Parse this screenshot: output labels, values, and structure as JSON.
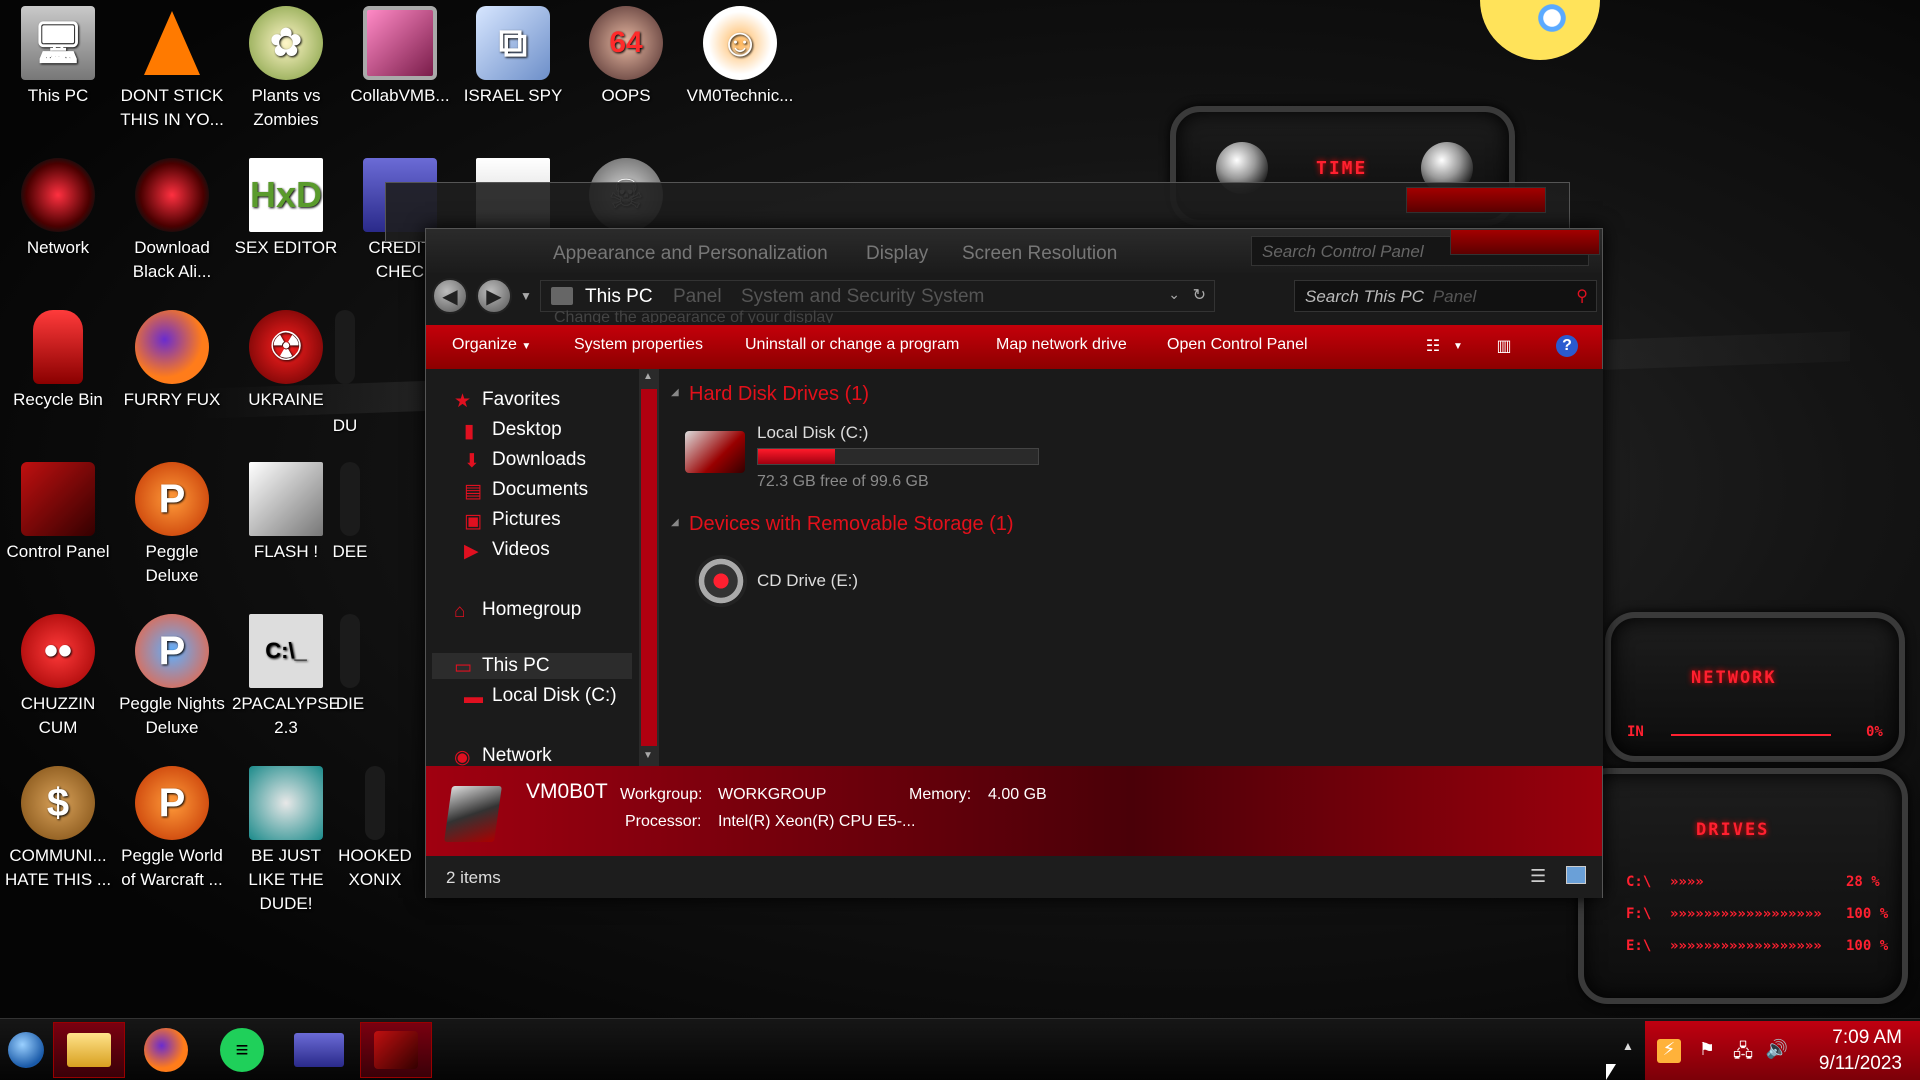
{
  "desktop_icons": [
    {
      "label": "This PC",
      "icon": "computer-icon"
    },
    {
      "label": "DONT STICK THIS IN YO...",
      "icon": "vlc-cone-icon"
    },
    {
      "label": "Plants vs Zombies",
      "icon": "plant-icon"
    },
    {
      "label": "CollabVMB...",
      "icon": "monitor-icon"
    },
    {
      "label": "ISRAEL SPY",
      "icon": "network-computers-icon"
    },
    {
      "label": "OOPS",
      "icon": "portrait-icon",
      "badge": "64"
    },
    {
      "label": "VM0Technic...",
      "icon": "doctor-icon"
    },
    {
      "label": "Network",
      "icon": "network-icon"
    },
    {
      "label": "Download Black Ali...",
      "icon": "alien-icon"
    },
    {
      "label": "SEX EDITOR",
      "icon": "hex-editor-icon",
      "glyph": "HxD"
    },
    {
      "label": "CREDIT CHEC",
      "icon": "credit-card-icon"
    },
    {
      "label": "",
      "icon": "document-icon"
    },
    {
      "label": "",
      "icon": "skull-icon"
    },
    {
      "label": "Recycle Bin",
      "icon": "recycle-bin-icon"
    },
    {
      "label": "FURRY FUX",
      "icon": "firefox-icon"
    },
    {
      "label": "UKRAINE",
      "icon": "radiation-icon"
    },
    {
      "label": "DU",
      "icon": "partial-icon"
    },
    {
      "label": "Control Panel",
      "icon": "control-panel-icon"
    },
    {
      "label": "Peggle Deluxe",
      "icon": "peggle-icon",
      "glyph": "P"
    },
    {
      "label": "FLASH !",
      "icon": "flash-icon"
    },
    {
      "label": "DEE",
      "icon": "partial-icon"
    },
    {
      "label": "CHUZZIN CUM",
      "icon": "chuzzle-icon"
    },
    {
      "label": "Peggle Nights Deluxe",
      "icon": "peggle-nights-icon",
      "glyph": "P"
    },
    {
      "label": "2PACALYPSE 2.3",
      "icon": "terminal-icon",
      "glyph": "C:\\_"
    },
    {
      "label": "DIE",
      "icon": "partial-icon"
    },
    {
      "label": "COMMUNI... HATE THIS ...",
      "icon": "money-bag-icon"
    },
    {
      "label": "Peggle World of Warcraft ...",
      "icon": "peggle-wow-icon",
      "glyph": "P"
    },
    {
      "label": "BE JUST LIKE THE DUDE!",
      "icon": "santa-icon"
    },
    {
      "label": "HOOKED XONIX",
      "icon": "partial-icon"
    }
  ],
  "widgets": {
    "time": {
      "title": "TIME"
    },
    "network": {
      "title": "NETWORK",
      "rows": [
        {
          "label": "IN",
          "value": "0%"
        },
        {
          "label": "",
          "value": ""
        }
      ]
    },
    "drives": {
      "title": "DRIVES",
      "rows": [
        {
          "label": "C:\\",
          "bar": "»»»»",
          "value": "28 %"
        },
        {
          "label": "F:\\",
          "bar": "»»»»»»»»»»»»»»»»»»",
          "value": "100 %"
        },
        {
          "label": "E:\\",
          "bar": "»»»»»»»»»»»»»»»»»»",
          "value": "100 %"
        }
      ]
    }
  },
  "background_window": {
    "breadcrumb": [
      "Appearance and Personalization",
      "Display",
      "Screen Resolution"
    ],
    "search_placeholder": "Search Control Panel",
    "subtitle": "Change the appearance of your display"
  },
  "explorer": {
    "address": "This PC",
    "address_ghost": [
      "Panel",
      "System and Security",
      "System"
    ],
    "search_placeholder": "Search This PC",
    "search_ghost": "Panel",
    "toolbar": {
      "organize": "Organize",
      "system_properties": "System properties",
      "uninstall": "Uninstall or change a program",
      "map_drive": "Map network drive",
      "open_cp": "Open Control Panel"
    },
    "nav": {
      "favorites": "Favorites",
      "desktop": "Desktop",
      "downloads": "Downloads",
      "documents": "Documents",
      "pictures": "Pictures",
      "videos": "Videos",
      "homegroup": "Homegroup",
      "this_pc": "This PC",
      "local_disk": "Local Disk (C:)",
      "network": "Network"
    },
    "groups": {
      "hdd": "Hard Disk Drives (1)",
      "removable": "Devices with Removable Storage (1)"
    },
    "drives": {
      "c": {
        "name": "Local Disk (C:)",
        "free": "72.3 GB free of 99.6 GB",
        "used_fraction": 0.274
      },
      "e": {
        "name": "CD Drive (E:)"
      }
    },
    "details": {
      "computer_name": "VM0B0T",
      "workgroup_label": "Workgroup:",
      "workgroup_value": "WORKGROUP",
      "memory_label": "Memory:",
      "memory_value": "4.00 GB",
      "processor_label": "Processor:",
      "processor_value": "Intel(R) Xeon(R) CPU E5-..."
    },
    "status": "2 items"
  },
  "taskbar": {
    "items": [
      "start-orb",
      "file-explorer",
      "firefox",
      "notes",
      "window-app",
      "control-panel"
    ],
    "time": "7:09 AM",
    "date": "9/11/2023"
  },
  "colors": {
    "accent_red": "#c4000a",
    "group_header_red": "#e3101a",
    "window_bg": "#1a1a1a"
  }
}
